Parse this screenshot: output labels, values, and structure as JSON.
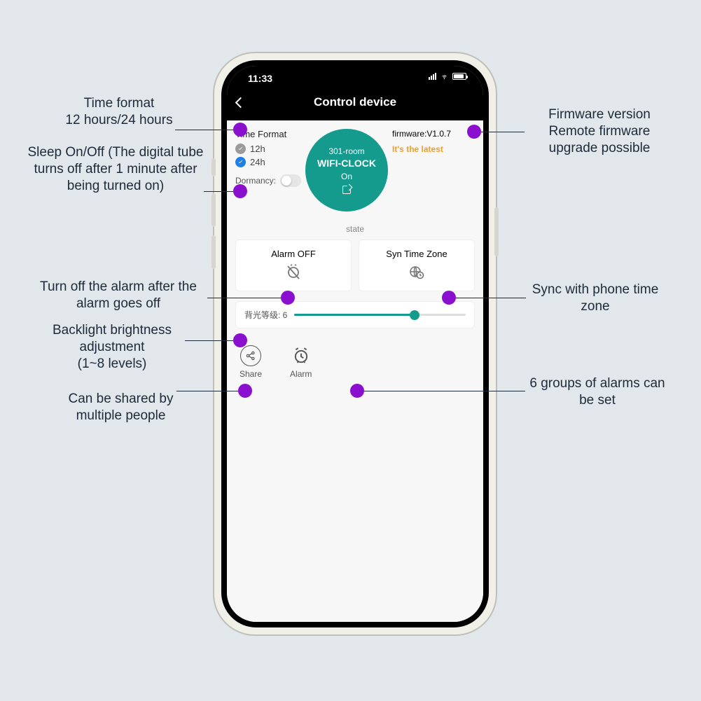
{
  "status": {
    "time": "11:33"
  },
  "header": {
    "title": "Control device"
  },
  "timeFormat": {
    "label": "Time Format",
    "opt12": "12h",
    "opt24": "24h",
    "selected": "24h"
  },
  "dormancy": {
    "label": "Dormancy:",
    "on": false
  },
  "device": {
    "room": "301-room",
    "name": "WIFI-CLOCK",
    "state": "On"
  },
  "firmware": {
    "version": "firmware:V1.0.7",
    "status": "It's the latest"
  },
  "stateLabel": "state",
  "cards": {
    "alarmOff": "Alarm OFF",
    "syncTz": "Syn Time Zone"
  },
  "backlight": {
    "label": "背光等级: 6",
    "value": 6,
    "min": 1,
    "max": 8
  },
  "actions": {
    "share": "Share",
    "alarm": "Alarm"
  },
  "annotations": {
    "timeFormat": "Time format\n12 hours/24 hours",
    "sleep": "Sleep On/Off (The digital tube turns off after 1 minute after being turned on)",
    "alarmOff": "Turn off the alarm after the alarm goes off",
    "backlight": "Backlight brightness adjustment\n(1~8 levels)",
    "share": "Can be shared by multiple people",
    "firmware": "Firmware version\nRemote firmware upgrade possible",
    "syncTz": "Sync with phone time zone",
    "alarms": "6 groups of alarms can be set"
  }
}
